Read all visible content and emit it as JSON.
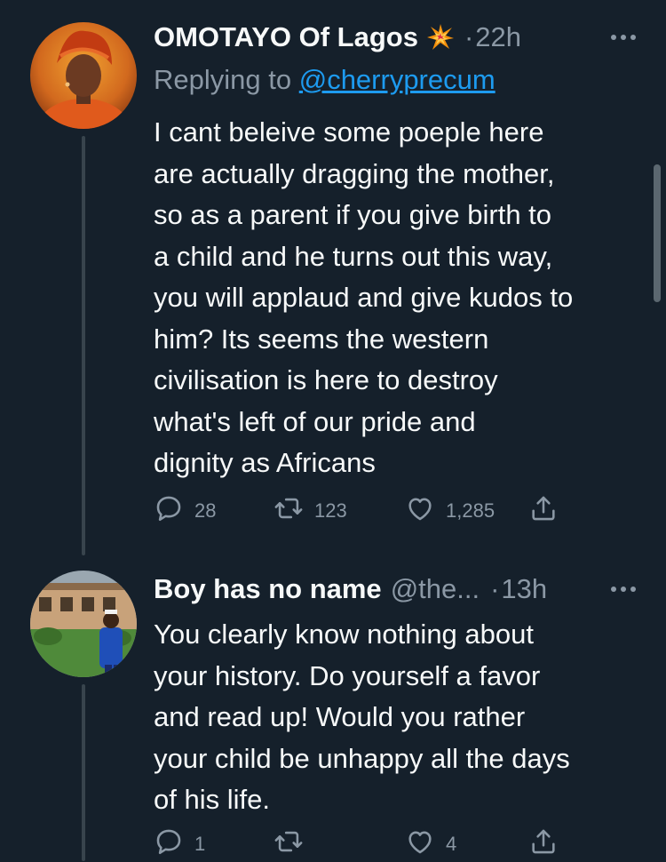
{
  "tweets": [
    {
      "name": "OMOTAYO Of Lagos",
      "emoji": "collision-burst",
      "dot": "·",
      "time": "22h",
      "replying_prefix": "Replying to ",
      "replying_handle": "@cherryprecum",
      "text": "I cant beleive some poeple here\nare actually dragging the mother,\nso as a parent if you give birth to\na child and he turns out this way,\nyou will applaud and give kudos to\nhim? Its seems the western\ncivilisation is here to destroy\nwhat's left of our pride and\ndignity as Africans",
      "replies": "28",
      "retweets": "123",
      "likes": "1,285"
    },
    {
      "name": "Boy has no name",
      "handle": "@the...",
      "dot": "·",
      "time": "13h",
      "text": "You clearly know nothing about\nyour history. Do yourself a favor\nand read up! Would you rather\nyour child be unhappy all the days\nof his life.",
      "replies": "1",
      "retweets": "",
      "likes": "4"
    }
  ],
  "colors": {
    "background": "#15202b",
    "text": "#f7f9f9",
    "secondary": "#8b98a5",
    "link": "#1d9bf0",
    "thread_line": "#38444d"
  },
  "icons": [
    "reply-icon",
    "retweet-icon",
    "like-icon",
    "share-icon",
    "more-icon"
  ]
}
